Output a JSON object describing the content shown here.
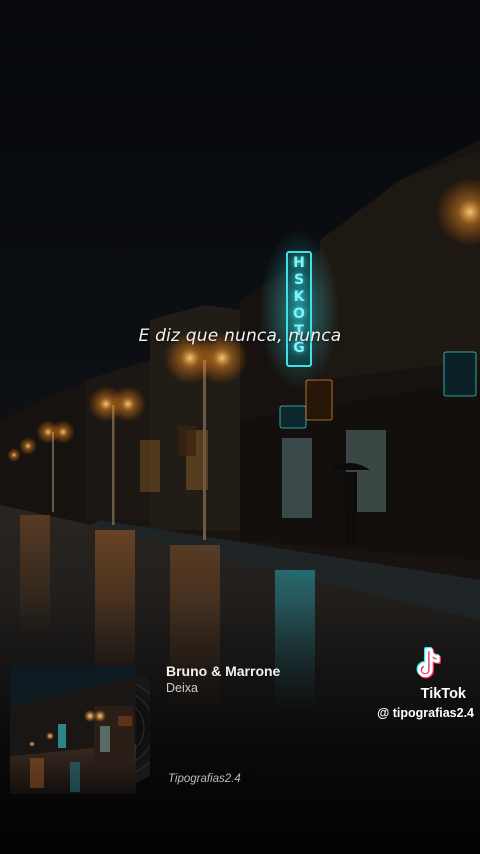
{
  "overlay": {
    "lyric": "E diz que nunca, nunca"
  },
  "sign": {
    "neon_text": "HSKOTG",
    "colors": {
      "neon": "#3fe0e8"
    }
  },
  "music": {
    "title": "Bruno & Marrone",
    "artist": "Deixa",
    "credit": "Tipografias2.4"
  },
  "tiktok": {
    "brand": "TikTok",
    "username": "@ tipografias2.4",
    "colors": {
      "cyan": "#25F4EE",
      "red": "#FE2C55",
      "white": "#FFFFFF"
    }
  }
}
